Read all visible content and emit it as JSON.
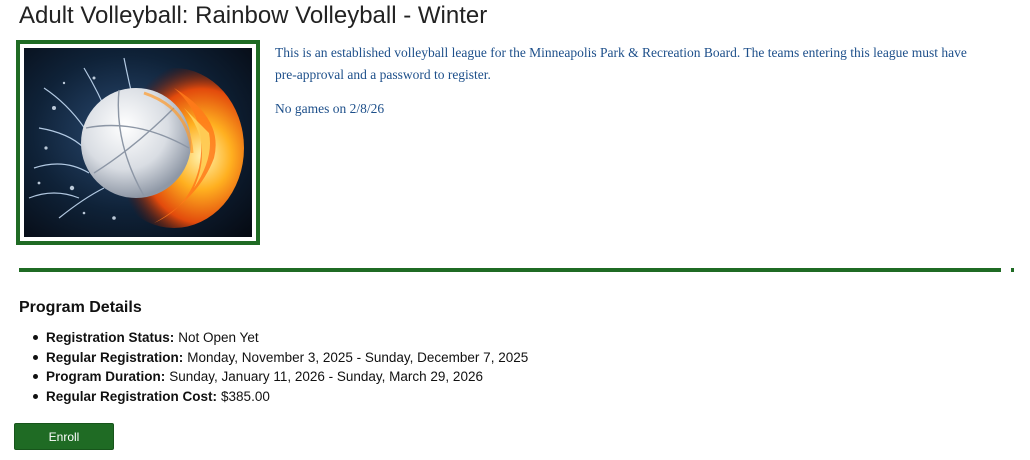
{
  "page": {
    "title": "Adult Volleyball: Rainbow Volleyball - Winter"
  },
  "program_image": {
    "subject": "volleyball with water splash and fire",
    "frame_color": "#1f6b24"
  },
  "description": {
    "paragraph_1": "This is an established volleyball league for the Minneapolis Park & Recreation Board. The teams entering this league must have pre-approval and a password to register.",
    "paragraph_2": "No games on 2/8/26",
    "text_color": "#1d4f8a"
  },
  "details": {
    "heading": "Program Details",
    "items": [
      {
        "label": "Registration Status:",
        "value": "Not Open Yet"
      },
      {
        "label": "Regular Registration:",
        "value": "Monday, November 3, 2025 - Sunday, December 7, 2025"
      },
      {
        "label": "Program Duration:",
        "value": "Sunday, January 11, 2026 - Sunday, March 29, 2026"
      },
      {
        "label": "Regular Registration Cost:",
        "value": "$385.00"
      }
    ]
  },
  "actions": {
    "enroll_label": "Enroll",
    "button_color": "#1f6b24"
  }
}
